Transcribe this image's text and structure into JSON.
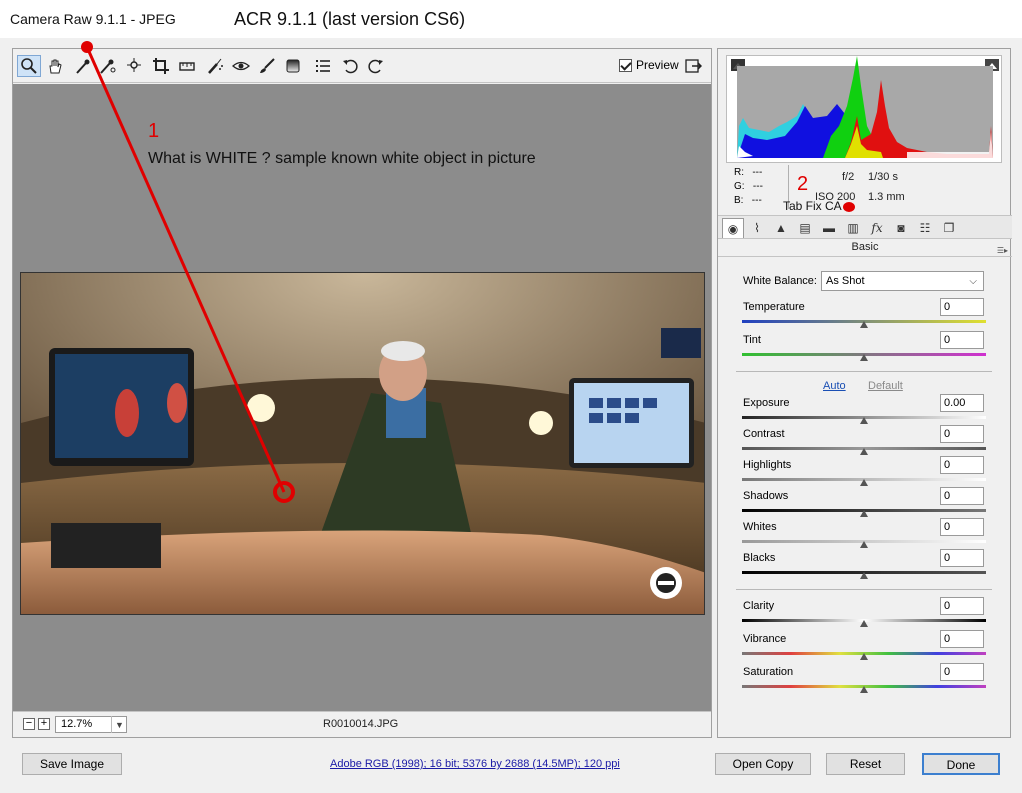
{
  "titlebar": {
    "app_title": "Camera Raw 9.1.1  -  JPEG",
    "annotation_title": "ACR 9.1.1 (last version CS6)"
  },
  "toolbar": {
    "tools": [
      "zoom-tool",
      "hand-tool",
      "white-balance-tool",
      "color-sampler-tool",
      "targeted-adjustment-tool",
      "crop-tool",
      "straighten-tool",
      "spot-removal-tool",
      "red-eye-tool",
      "adjustment-brush-tool",
      "graduated-filter-tool",
      "preferences-icon",
      "rotate-ccw-icon",
      "rotate-cw-icon"
    ],
    "preview_label": "Preview",
    "preview_checked": true
  },
  "annotations": {
    "step1_number": "1",
    "step1_text": "What is WHITE ?  sample known white object in picture",
    "step2_number": "2",
    "step2_text": "Tab Fix CA",
    "color": "#e00000"
  },
  "statusbar": {
    "zoom": "12.7%",
    "filename": "R0010014.JPG"
  },
  "readouts": {
    "r_label": "R:",
    "r_value": "---",
    "g_label": "G:",
    "g_value": "---",
    "b_label": "B:",
    "b_value": "---",
    "aperture": "f/2",
    "shutter": "1/30 s",
    "iso": "ISO 200",
    "focal": "1.3 mm"
  },
  "panel": {
    "title": "Basic",
    "tabs": [
      "basic-tab",
      "tone-curve-tab",
      "detail-tab",
      "hsl-tab",
      "split-toning-tab",
      "lens-corrections-tab",
      "effects-tab",
      "camera-calibration-tab",
      "presets-tab",
      "snapshots-tab"
    ],
    "white_balance_label": "White Balance:",
    "white_balance_value": "As Shot",
    "auto_label": "Auto",
    "default_label": "Default",
    "sliders": [
      {
        "label": "Temperature",
        "value": "0",
        "position": 0.5
      },
      {
        "label": "Tint",
        "value": "0",
        "position": 0.5
      },
      {
        "label": "Exposure",
        "value": "0.00",
        "position": 0.5
      },
      {
        "label": "Contrast",
        "value": "0",
        "position": 0.5
      },
      {
        "label": "Highlights",
        "value": "0",
        "position": 0.5
      },
      {
        "label": "Shadows",
        "value": "0",
        "position": 0.5
      },
      {
        "label": "Whites",
        "value": "0",
        "position": 0.5
      },
      {
        "label": "Blacks",
        "value": "0",
        "position": 0.5
      },
      {
        "label": "Clarity",
        "value": "0",
        "position": 0.5
      },
      {
        "label": "Vibrance",
        "value": "0",
        "position": 0.5
      },
      {
        "label": "Saturation",
        "value": "0",
        "position": 0.5
      }
    ]
  },
  "footer": {
    "save_label": "Save Image",
    "workflow_link": "Adobe RGB (1998); 16 bit; 5376 by 2688 (14.5MP); 120 ppi",
    "open_copy_label": "Open Copy",
    "reset_label": "Reset",
    "done_label": "Done"
  },
  "colors": {
    "accent": "#3c7fcf",
    "link": "#1a1aa6",
    "annotation": "#e00000"
  }
}
